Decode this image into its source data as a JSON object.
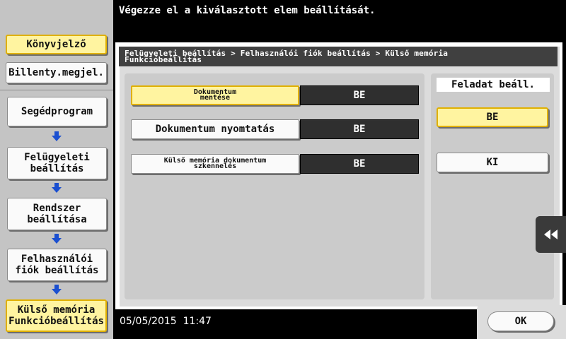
{
  "header": {
    "message": "Végezze el a kiválasztott elem beállítását."
  },
  "sidebar": {
    "top_buttons": [
      {
        "label": "Könyvjelző",
        "active": true
      },
      {
        "label": "Billenty.megjel.",
        "active": false
      }
    ],
    "path": [
      {
        "label": "Segédprogram",
        "active": false
      },
      {
        "label": "Felügyeleti\nbeállítás",
        "active": false
      },
      {
        "label": "Rendszer\nbeállítása",
        "active": false
      },
      {
        "label": "Felhasználói\nfiók beállítás",
        "active": false
      },
      {
        "label": "Külső memória\nFunkcióbeállítás",
        "active": true
      }
    ],
    "arrow_icon": "arrow-down-icon"
  },
  "breadcrumb": "Felügyeleti beállítás > Felhasználói fiók beállítás > Külső memória\nFunkcióbeállítás",
  "settings": [
    {
      "label": "Dokumentum\nmentése",
      "value": "BE",
      "selected": true
    },
    {
      "label": "Dokumentum nyomtatás",
      "value": "BE",
      "selected": false
    },
    {
      "label": "Külső memória dokumentum\nszkennelés",
      "value": "BE",
      "selected": false
    }
  ],
  "task_setting": {
    "label": "Feladat beáll.",
    "options": [
      {
        "label": "BE",
        "selected": true
      },
      {
        "label": "KI",
        "selected": false
      }
    ]
  },
  "footer": {
    "date": "05/05/2015",
    "time": "11:47",
    "ok_label": "OK"
  },
  "colors": {
    "highlight_fill": "#fff4a0",
    "highlight_border": "#e0b000",
    "arrow_blue": "#1a4fd0",
    "value_bg": "#2f2f2f"
  }
}
